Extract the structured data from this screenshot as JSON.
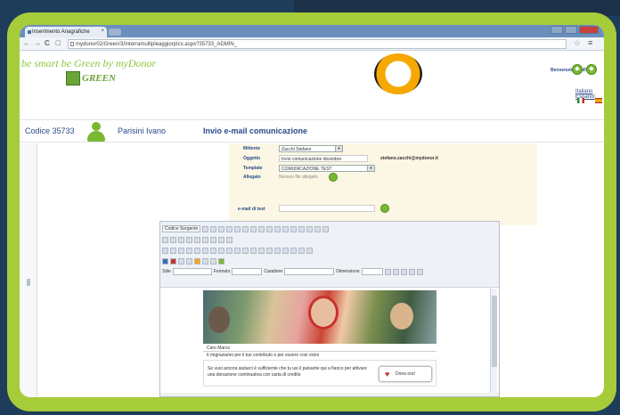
{
  "browser": {
    "tab_title": "Inserimento Anagrafiche",
    "url": "mydonor02/Green/3/InterramultipleaggiorpIcx.aspx?35733_ADMIN_"
  },
  "header": {
    "tagline": "be smart be Green by myDonor",
    "logo_text": "GREEN",
    "welcome": "Benvenuto ADMIN",
    "language_link": "Italiano Español"
  },
  "infobar": {
    "codice": "Codice 35733",
    "user_name": "Parisini Ivano",
    "page_title": "Invio e-mail comunicazione"
  },
  "form": {
    "mittente_label": "Mittente",
    "mittente_value": "Zacchi Stefano",
    "mittente_email": "stefano.zacchi@mydonor.it",
    "oggetto_label": "Oggetto",
    "oggetto_value": "Invio comunicazione dicembre",
    "template_label": "Template",
    "template_value": "COMUNICAZIONE TEST",
    "allegato_label": "Allegato",
    "allegato_value": "Nessun file allegato",
    "test_label": "e-mail di test"
  },
  "editor": {
    "source_button": "Codice Sorgente",
    "style_label": "Stile",
    "format_label": "Formato",
    "font_label": "Carattere",
    "size_label": "Dimensione"
  },
  "mail": {
    "greeting": "Caro Marco",
    "thanks": "ti ringraziamo per il tuo contributo e per essere così vicini",
    "appeal": "Se vuoi ancora aiutarci è sufficiente che tu usi il pulsante qui a fianco per attivare una donazione continuativa con carta di credito",
    "donate_button": "Dona ora!"
  },
  "colors": {
    "frame": "#a6cc3a",
    "brand_green": "#7bb832",
    "brand_blue": "#2a4a8a"
  }
}
